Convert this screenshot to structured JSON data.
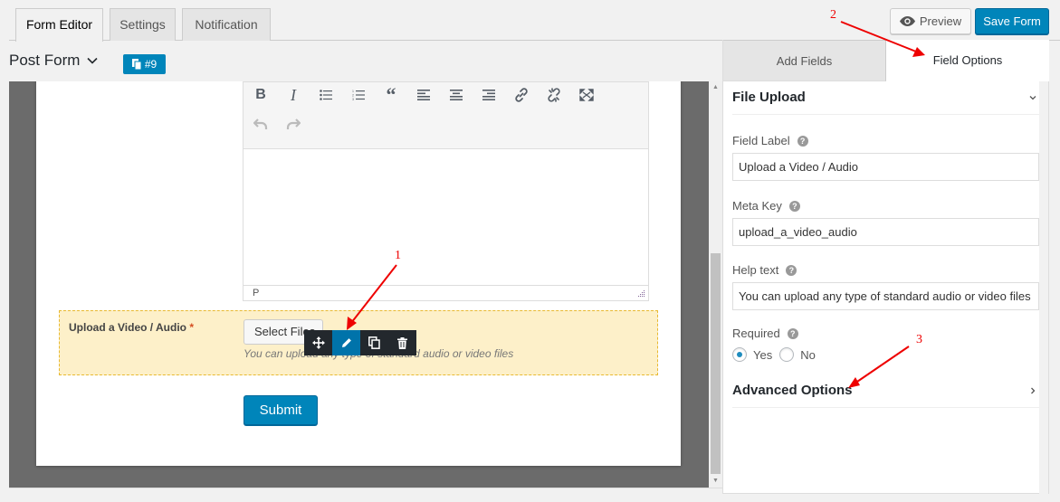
{
  "tabs": [
    {
      "label": "Form Editor",
      "active": true
    },
    {
      "label": "Settings",
      "active": false
    },
    {
      "label": "Notification",
      "active": false
    }
  ],
  "actions": {
    "preview_label": "Preview",
    "preview_icon": "eye-icon",
    "save_label": "Save Form"
  },
  "form": {
    "title": "Post Form",
    "id_badge": "#9",
    "id_icon": "copy-icon"
  },
  "editor": {
    "toolbar_row1": [
      "bold",
      "italic",
      "bulleted-list",
      "numbered-list",
      "blockquote",
      "align-left",
      "align-center",
      "align-right",
      "link",
      "unlink",
      "fullscreen"
    ],
    "toolbar_row2": [
      "undo",
      "redo"
    ],
    "status_path": "P"
  },
  "field": {
    "label": "Upload a Video / Audio",
    "required_mark": "*",
    "button_label": "Select Files",
    "help_text": "You can upload any type of standard audio or video files",
    "actions": [
      "move",
      "edit",
      "duplicate",
      "delete"
    ]
  },
  "submit_label": "Submit",
  "panel": {
    "tabs": [
      {
        "label": "Add Fields",
        "active": false
      },
      {
        "label": "Field Options",
        "active": true
      }
    ],
    "section_title": "File Upload",
    "field_label_label": "Field Label",
    "field_label_value": "Upload a Video / Audio",
    "meta_key_label": "Meta Key",
    "meta_key_value": "upload_a_video_audio",
    "help_text_label": "Help text",
    "help_text_value": "You can upload any type of standard audio or video files",
    "required_label": "Required",
    "required_options": [
      {
        "label": "Yes",
        "checked": true
      },
      {
        "label": "No",
        "checked": false
      }
    ],
    "advanced_title": "Advanced Options"
  },
  "annotations": [
    "1",
    "2",
    "3"
  ],
  "colors": {
    "primary": "#0085ba",
    "annotation": "#e00000",
    "field_highlight": "#fdf0c9"
  }
}
